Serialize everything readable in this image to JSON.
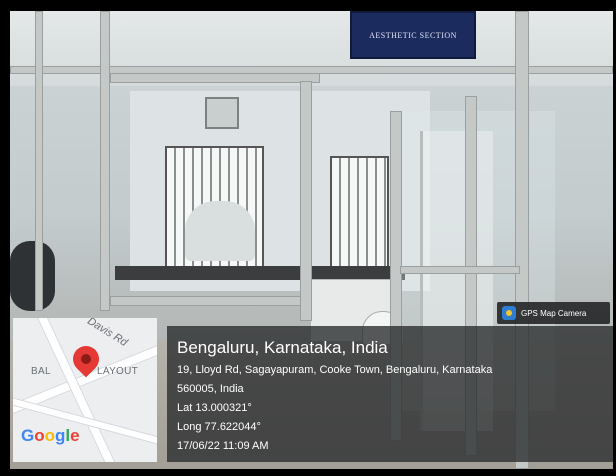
{
  "photo": {
    "sign_text": "AESTHETIC SECTION"
  },
  "map": {
    "street_label": "Davis Rd",
    "area_label_left": "BAL",
    "area_label_right": "LAYOUT",
    "provider": [
      "G",
      "o",
      "o",
      "g",
      "l",
      "e"
    ],
    "provider_colors": [
      "#4285f4",
      "#ea4335",
      "#fbbc05",
      "#4285f4",
      "#34a853",
      "#ea4335"
    ]
  },
  "overlay": {
    "place": "Bengaluru, Karnataka, India",
    "address_line1": "19, Lloyd Rd, Sagayapuram, Cooke Town, Bengaluru, Karnataka",
    "address_line2": "560005, India",
    "latitude": "Lat 13.000321°",
    "longitude": "Long 77.622044°",
    "timestamp": "17/06/22 11:09 AM"
  },
  "badge": {
    "icon": "gps-map-camera-icon",
    "label": "GPS Map Camera"
  }
}
